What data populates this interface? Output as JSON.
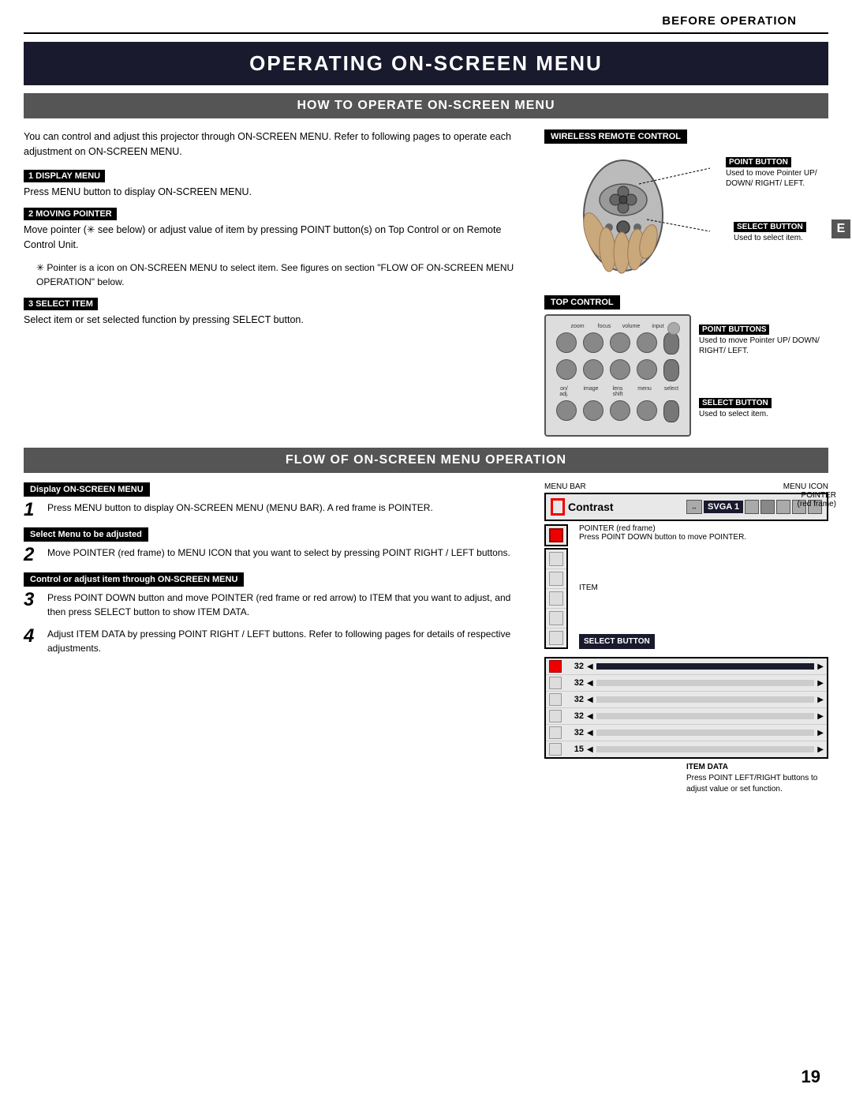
{
  "header": {
    "before_operation": "BEFORE OPERATION"
  },
  "main_title": "OPERATING ON-SCREEN MENU",
  "section1": {
    "title": "HOW TO OPERATE ON-SCREEN MENU",
    "intro": "You can control and adjust this projector through ON-SCREEN MENU.  Refer to following pages to operate each adjustment on ON-SCREEN MENU.",
    "step1_label": "1  DISPLAY MENU",
    "step1_text": "Press MENU button to display ON-SCREEN MENU.",
    "step2_label": "2  MOVING POINTER",
    "step2_text": "Move pointer (✳ see below) or adjust value of item by pressing POINT button(s) on Top Control or on Remote Control Unit.",
    "note": "✳  Pointer is a icon on ON-SCREEN MENU to select item. See figures on section \"FLOW OF ON-SCREEN MENU OPERATION\" below.",
    "step3_label": "3  SELECT ITEM",
    "step3_text": "Select item or set selected function by pressing SELECT button.",
    "wireless_label": "WIRELESS REMOTE CONTROL",
    "point_button_label": "POINT BUTTON",
    "point_button_desc": "Used to move Pointer UP/ DOWN/ RIGHT/ LEFT.",
    "select_button_label": "SELECT BUTTON",
    "select_button_desc": "Used to select item.",
    "top_control_label": "TOP CONTROL",
    "point_buttons_label": "POINT BUTTONS",
    "point_buttons_desc": "Used to move Pointer UP/ DOWN/ RIGHT/ LEFT.",
    "select_button2_label": "SELECT BUTTON",
    "select_button2_desc": "Used to select item."
  },
  "section2": {
    "title": "FLOW OF ON-SCREEN MENU OPERATION",
    "display_header": "Display ON-SCREEN MENU",
    "step1_num": "1",
    "step1_text": "Press MENU button to display ON-SCREEN MENU (MENU BAR).  A red frame is POINTER.",
    "select_header": "Select Menu to be adjusted",
    "step2_num": "2",
    "step2_text": "Move POINTER (red frame) to MENU ICON that you want to select by pressing POINT RIGHT / LEFT buttons.",
    "control_header": "Control or adjust item through ON-SCREEN MENU",
    "step3_num": "3",
    "step3_text": "Press POINT DOWN button and move POINTER (red frame or red arrow) to ITEM that you want to adjust, and then press SELECT button to show ITEM DATA.",
    "step4_num": "4",
    "step4_text": "Adjust ITEM DATA by pressing POINT RIGHT / LEFT buttons.\nRefer to following pages for details of respective adjustments.",
    "menu_bar_label": "MENU BAR",
    "menu_icon_label": "MENU ICON",
    "pointer_label": "POINTER",
    "pointer_desc": "(red frame)",
    "pointer_desc2": "Press POINT DOWN button to move POINTER.",
    "item_label": "ITEM",
    "select_button_box": "SELECT\nBUTTON",
    "item_data_label": "ITEM DATA",
    "item_data_desc": "Press POINT LEFT/RIGHT buttons to adjust value or set function.",
    "contrast_label": "Contrast",
    "svga_label": "SVGA 1",
    "data_rows": [
      {
        "icon": "sun",
        "num": "32",
        "has_bar": false
      },
      {
        "icon": "sun2",
        "num": "32",
        "has_bar": false
      },
      {
        "icon": "color",
        "num": "32",
        "has_bar": false
      },
      {
        "icon": "tint",
        "num": "32",
        "has_bar": false
      },
      {
        "icon": "picture",
        "num": "32",
        "has_bar": false
      },
      {
        "icon": "gamma",
        "num": "15",
        "has_bar": false
      }
    ]
  },
  "page_number": "19"
}
